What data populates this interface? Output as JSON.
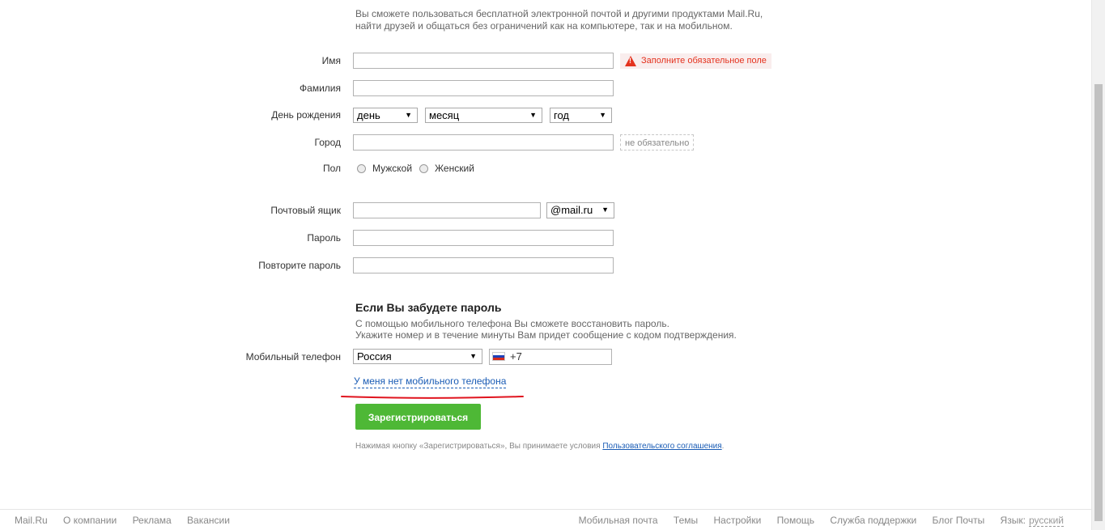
{
  "intro": {
    "line1": "Вы сможете пользоваться бесплатной электронной почтой и другими продуктами Mail.Ru,",
    "line2": "найти друзей и общаться без ограничений как на компьютере, так и на мобильном."
  },
  "form": {
    "first_name_label": "Имя",
    "first_name_error": "Заполните обязательное поле",
    "last_name_label": "Фамилия",
    "birthday_label": "День рождения",
    "day_select": "день",
    "month_select": "месяц",
    "year_select": "год",
    "city_label": "Город",
    "city_hint": "не обязательно",
    "gender_label": "Пол",
    "gender_male": "Мужской",
    "gender_female": "Женский",
    "mailbox_label": "Почтовый ящик",
    "domain_select": "@mail.ru",
    "password_label": "Пароль",
    "repeat_password_label": "Повторите пароль"
  },
  "recovery": {
    "title": "Если Вы забудете пароль",
    "text_line1": "С помощью мобильного телефона Вы сможете восстановить пароль.",
    "text_line2": "Укажите номер и в течение минуты Вам придет сообщение с кодом подтверждения.",
    "phone_label": "Мобильный телефон",
    "country_select": "Россия",
    "phone_code": "+7",
    "no_phone_link": "У меня нет мобильного телефона"
  },
  "actions": {
    "register_button": "Зарегистрироваться",
    "terms_prefix": "Нажимая кнопку «Зарегистрироваться», Вы принимаете условия ",
    "terms_link": "Пользовательского соглашения",
    "terms_suffix": "."
  },
  "footer": {
    "left": [
      "Mail.Ru",
      "О компании",
      "Реклама",
      "Вакансии"
    ],
    "right": [
      "Мобильная почта",
      "Темы",
      "Настройки",
      "Помощь",
      "Служба поддержки",
      "Блог Почты"
    ],
    "language_label": "Язык:",
    "language_value": "русский"
  },
  "colors": {
    "accent_green": "#4eb836",
    "error_red": "#e4321e",
    "link_blue": "#1a5cb5",
    "annotation_red": "#e0141e"
  }
}
